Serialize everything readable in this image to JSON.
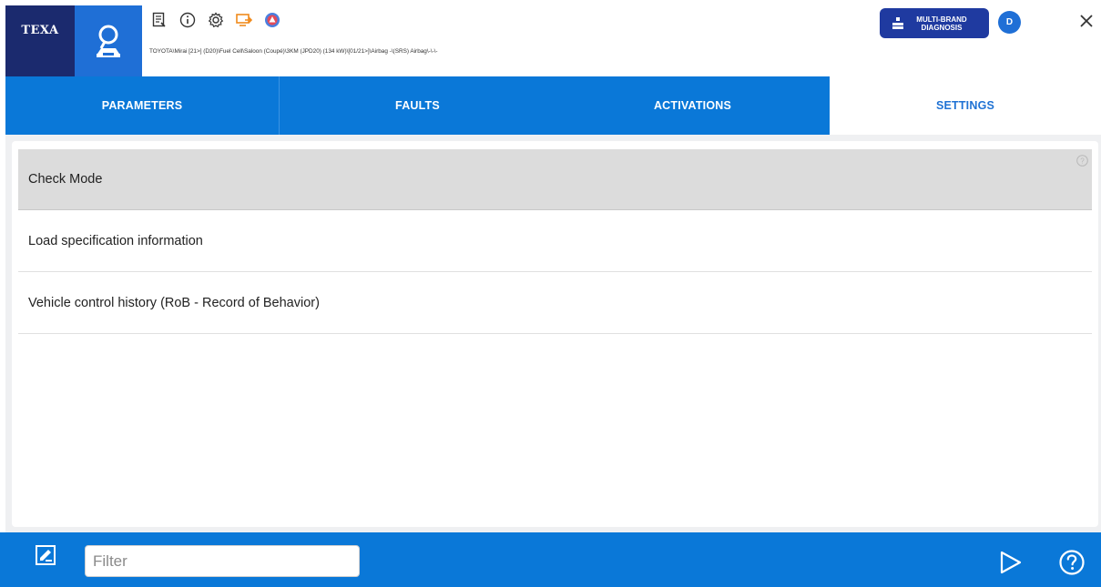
{
  "header": {
    "logo_text": "TEXA",
    "toolbar_icons": [
      "document-icon",
      "info-icon",
      "gear-icon",
      "screen-share-icon",
      "cloud-triangle-icon"
    ],
    "breadcrumb": "TOYOTA\\Mirai [21>] (D20)\\Fuel Cell\\Saloon (Coupé)\\3KM (JPD20) (134 kW)\\[01/21>]\\Airbag -\\(SRS) Airbag\\-\\-\\-",
    "multibrand_label": "MULTI-BRAND\nDIAGNOSIS",
    "avatar_initial": "D"
  },
  "tabs": [
    {
      "label": "PARAMETERS",
      "active": false
    },
    {
      "label": "FAULTS",
      "active": false
    },
    {
      "label": "ACTIVATIONS",
      "active": false
    },
    {
      "label": "SETTINGS",
      "active": true
    }
  ],
  "settings_list": [
    {
      "label": "Check Mode",
      "selected": true
    },
    {
      "label": "Load specification information",
      "selected": false
    },
    {
      "label": "Vehicle control history (RoB - Record of Behavior)",
      "selected": false
    }
  ],
  "footer": {
    "filter_placeholder": "Filter",
    "filter_value": ""
  },
  "colors": {
    "brand_dark": "#1b2a6e",
    "tab_blue": "#0a78d8",
    "accent_blue": "#1f6fd6",
    "multibrand_blue": "#1f3aa0",
    "selected_row": "#dcdcdc",
    "active_tab_text": "#1f72d4"
  }
}
